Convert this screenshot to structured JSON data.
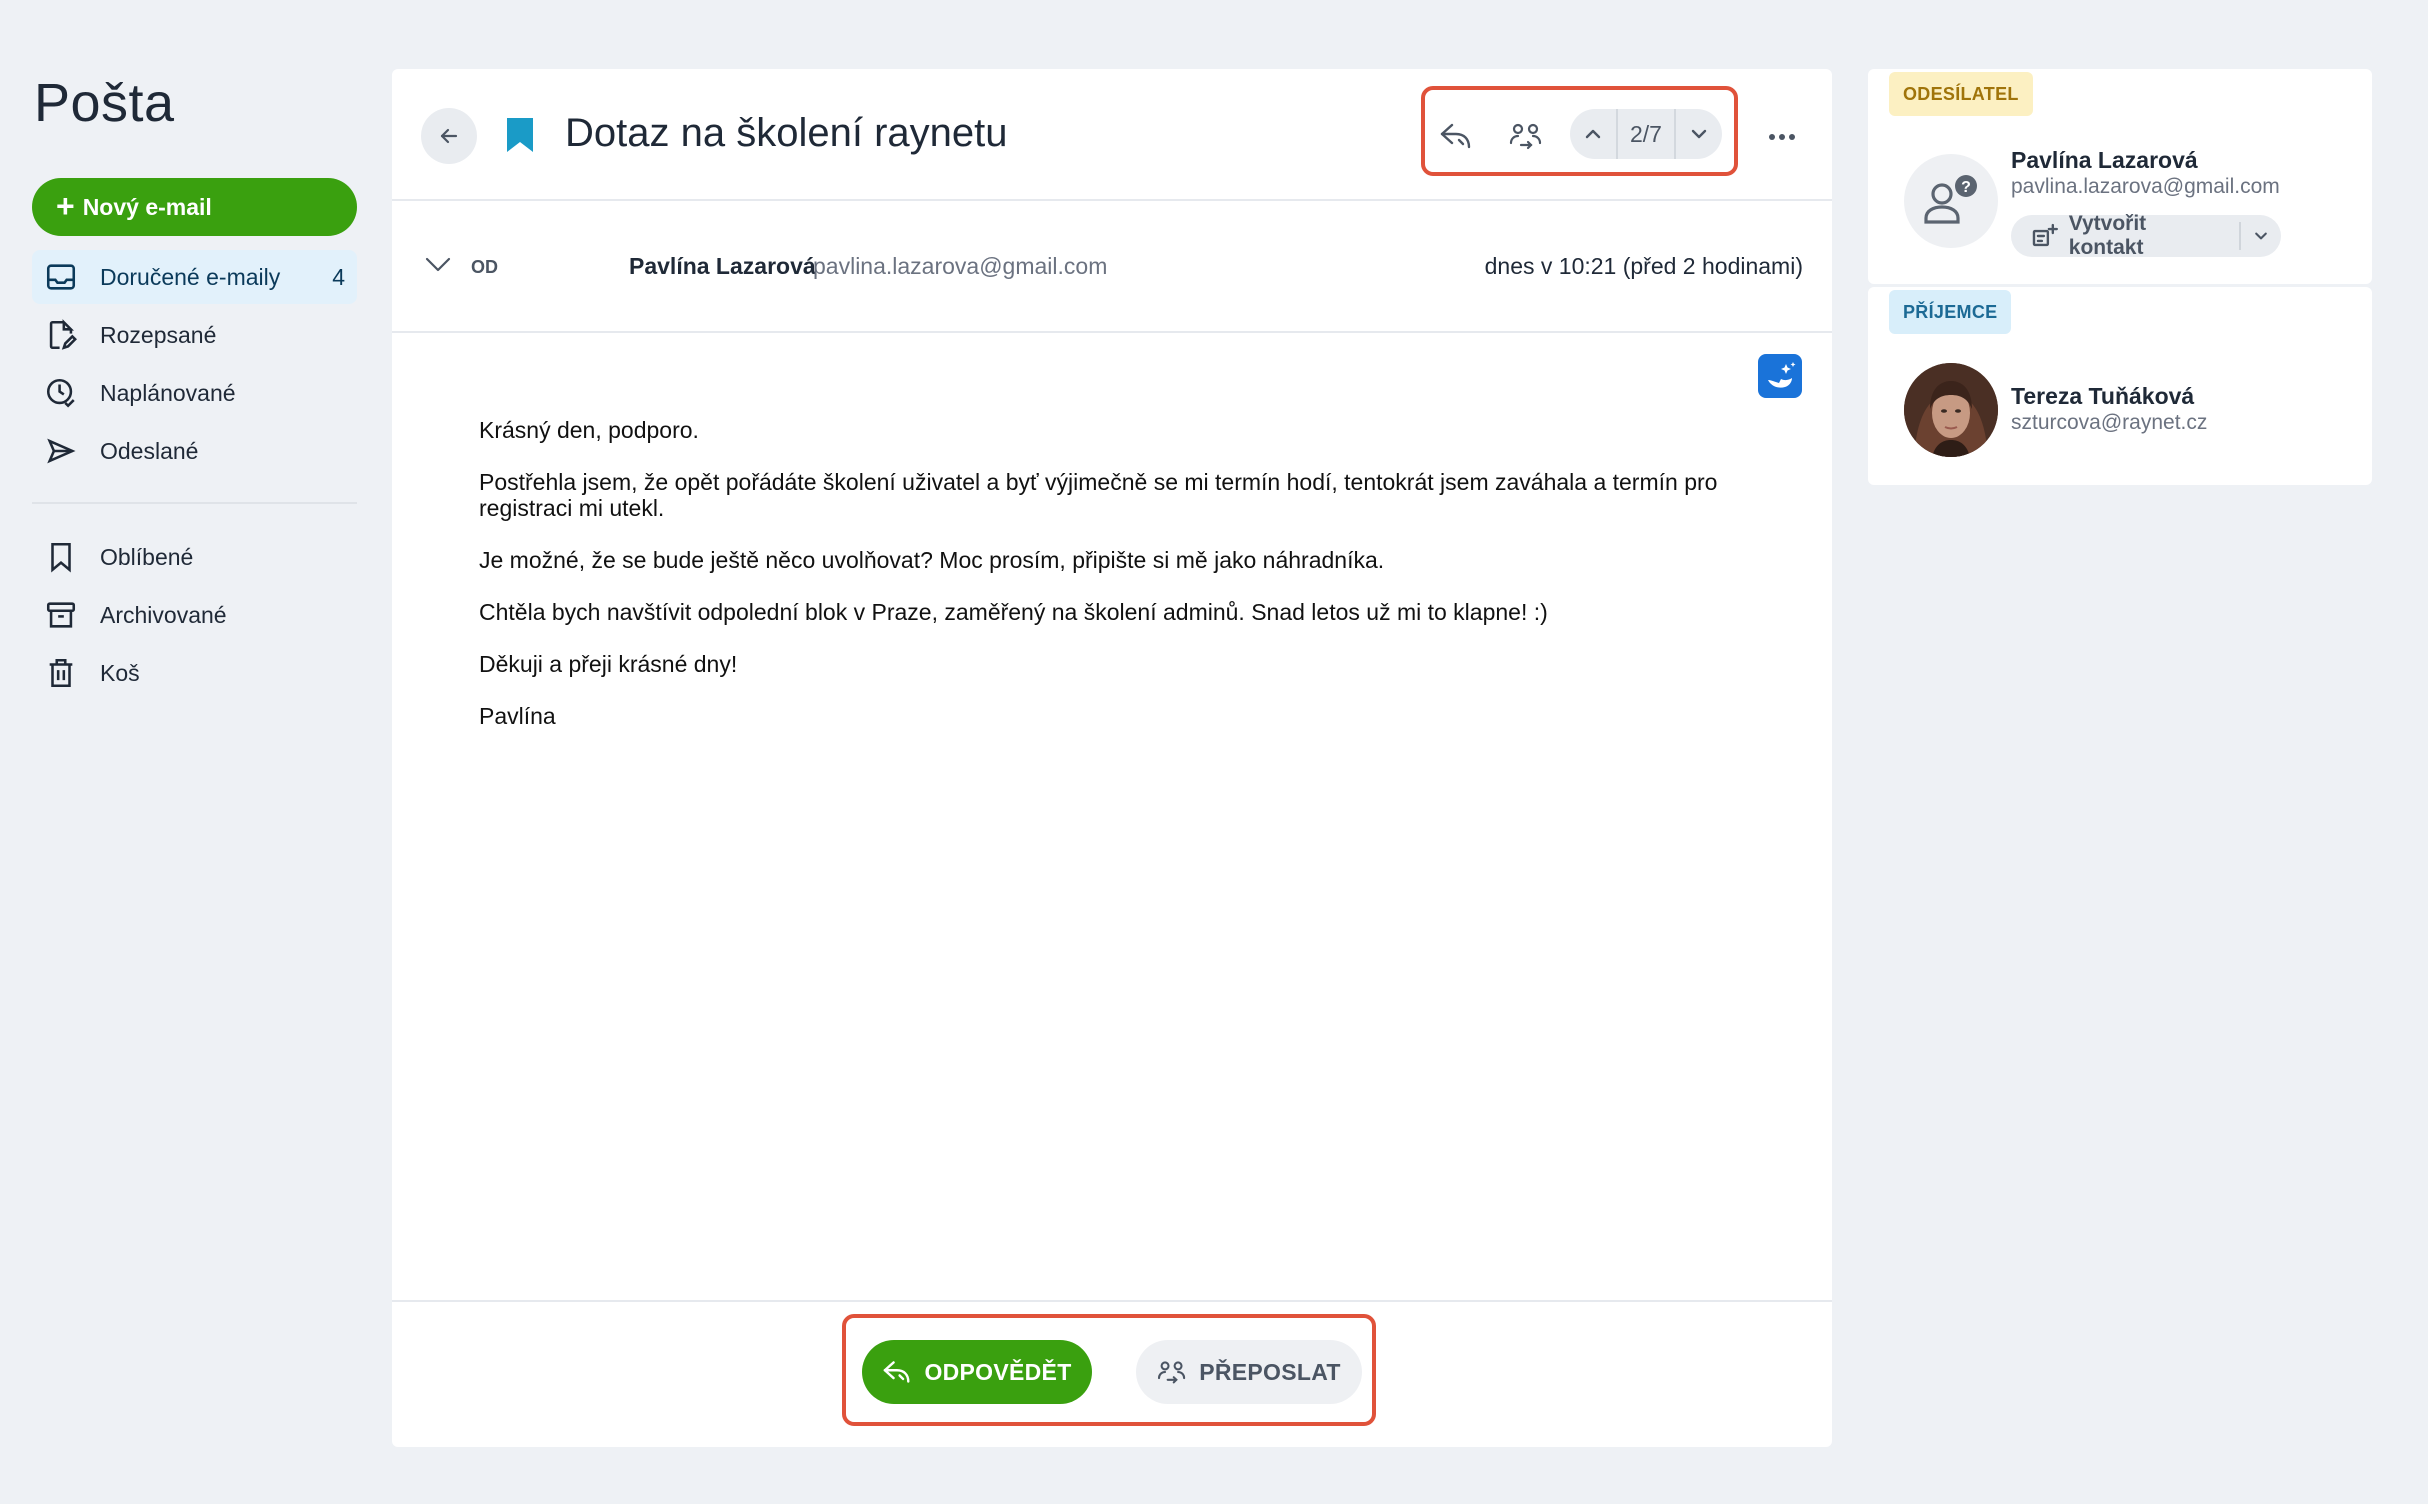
{
  "app": {
    "title": "Pošta"
  },
  "sidebar": {
    "new_mail_label": "Nový e-mail",
    "items": [
      {
        "label": "Doručené e-maily",
        "count": "4",
        "icon": "inbox-icon",
        "active": true
      },
      {
        "label": "Rozepsané",
        "icon": "draft-icon"
      },
      {
        "label": "Naplánované",
        "icon": "scheduled-icon"
      },
      {
        "label": "Odeslané",
        "icon": "sent-icon"
      },
      {
        "label": "Oblíbené",
        "icon": "bookmark-icon"
      },
      {
        "label": "Archivované",
        "icon": "archive-icon"
      },
      {
        "label": "Koš",
        "icon": "trash-icon"
      }
    ]
  },
  "mail": {
    "subject": "Dotaz na školení raynetu",
    "pager": "2/7",
    "from_label": "OD",
    "from_name": "Pavlína Lazarová",
    "from_email": "pavlina.lazarova@gmail.com",
    "date": "dnes v 10:21 (před 2 hodinami)",
    "body": [
      "Krásný den, podporo.",
      "Postřehla jsem, že opět pořádáte školení uživatel a byť výjimečně se mi termín hodí, tentokrát jsem zaváhala a termín pro registraci mi utekl.",
      "Je možné, že se bude ještě něco uvolňovat? Moc prosím, připište si mě jako náhradníka.",
      "Chtěla bych navštívit odpolední blok v Praze, zaměřený na školení adminů. Snad letos už mi to klapne! :)",
      "Děkuji a přeji krásné dny!",
      "Pavlína"
    ],
    "reply_label": "ODPOVĚDĚT",
    "forward_label": "PŘEPOSLAT"
  },
  "sender_card": {
    "badge": "ODESÍLATEL",
    "name": "Pavlína Lazarová",
    "email": "pavlina.lazarova@gmail.com",
    "create_contact_label": "Vytvořit kontakt"
  },
  "recipient_card": {
    "badge": "PŘÍJEMCE",
    "name": "Tereza Tuňáková",
    "email": "szturcova@raynet.cz"
  },
  "colors": {
    "accent_green": "#3aa00f",
    "highlight_red": "#e0523a",
    "bookmark_blue": "#1a9bc7"
  }
}
